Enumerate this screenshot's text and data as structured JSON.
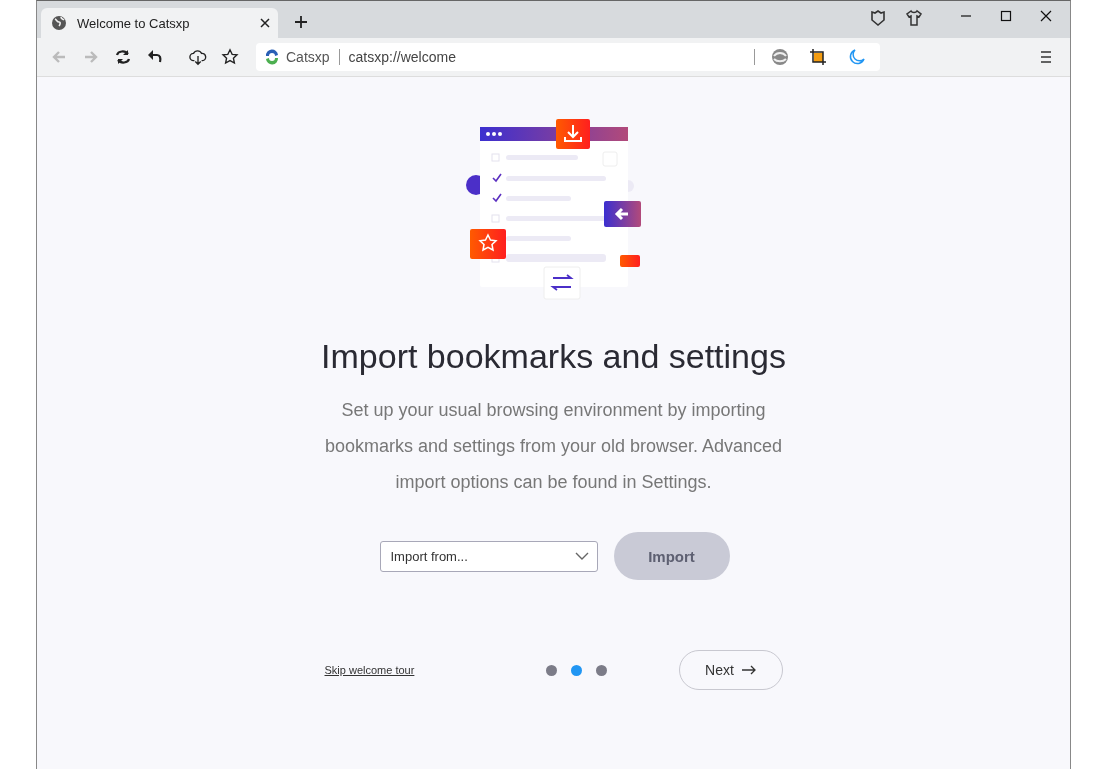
{
  "tabs": [
    {
      "title": "Welcome to Catsxp",
      "selected": true
    }
  ],
  "address_bar": {
    "site_name": "Catsxp",
    "url": "catsxp://welcome"
  },
  "heading": "Import bookmarks and settings",
  "description": "Set up your usual browsing environment by importing bookmarks and settings from your old browser. Advanced import options can be found in Settings.",
  "import_select": {
    "placeholder": "Import from..."
  },
  "import_button": {
    "label": "Import",
    "disabled": true
  },
  "skip_link": "Skip welcome tour",
  "steps": [
    {
      "selected": false
    },
    {
      "selected": true
    },
    {
      "selected": false
    }
  ],
  "next_button": "Next"
}
